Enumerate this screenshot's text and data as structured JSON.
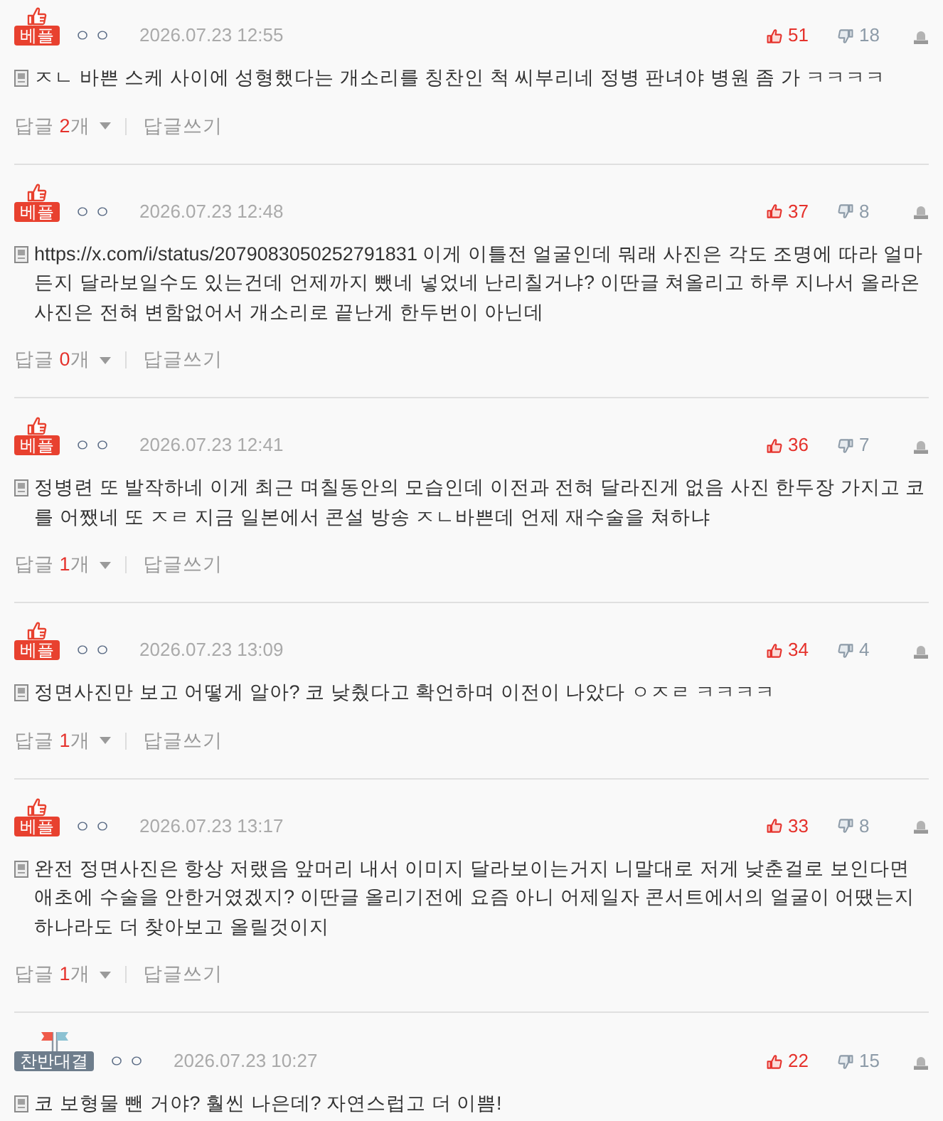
{
  "comments": [
    {
      "badge": {
        "kind": "best",
        "label": "베플"
      },
      "author": "ㅇㅇ",
      "date": "2026.07.23 12:55",
      "likes": "51",
      "dislikes": "18",
      "text": "ㅈㄴ 바쁜 스케 사이에 성형했다는 개소리를 칭찬인 척 씨부리네 정병 판녀야 병원 좀 가 ㅋㅋㅋㅋ",
      "replies": {
        "label": "답글",
        "count": "2",
        "unit": "개",
        "write": "답글쓰기"
      }
    },
    {
      "badge": {
        "kind": "best",
        "label": "베플"
      },
      "author": "ㅇㅇ",
      "date": "2026.07.23 12:48",
      "likes": "37",
      "dislikes": "8",
      "text": "https://x.com/i/status/2079083050252791831 이게 이틀전 얼굴인데 뭐래 사진은 각도 조명에 따라 얼마든지 달라보일수도 있는건데 언제까지 뺐네 넣었네 난리칠거냐? 이딴글 쳐올리고 하루 지나서 올라온 사진은 전혀 변함없어서 개소리로 끝난게 한두번이 아닌데",
      "replies": {
        "label": "답글",
        "count": "0",
        "unit": "개",
        "write": "답글쓰기"
      }
    },
    {
      "badge": {
        "kind": "best",
        "label": "베플"
      },
      "author": "ㅇㅇ",
      "date": "2026.07.23 12:41",
      "likes": "36",
      "dislikes": "7",
      "text": "정병련 또 발작하네 이게 최근 며칠동안의 모습인데 이전과 전혀 달라진게 없음 사진 한두장 가지고 코를 어쨌네 또 ㅈㄹ 지금 일본에서 콘설 방송 ㅈㄴ바쁜데 언제 재수술을 쳐하냐",
      "replies": {
        "label": "답글",
        "count": "1",
        "unit": "개",
        "write": "답글쓰기"
      }
    },
    {
      "badge": {
        "kind": "best",
        "label": "베플"
      },
      "author": "ㅇㅇ",
      "date": "2026.07.23 13:09",
      "likes": "34",
      "dislikes": "4",
      "text": "정면사진만 보고 어떻게 알아? 코 낮췄다고 확언하며 이전이 나았다 ㅇㅈㄹ ㅋㅋㅋㅋ",
      "replies": {
        "label": "답글",
        "count": "1",
        "unit": "개",
        "write": "답글쓰기"
      }
    },
    {
      "badge": {
        "kind": "best",
        "label": "베플"
      },
      "author": "ㅇㅇ",
      "date": "2026.07.23 13:17",
      "likes": "33",
      "dislikes": "8",
      "text": "완전 정면사진은 항상 저랬음 앞머리 내서 이미지 달라보이는거지 니말대로 저게 낮춘걸로 보인다면 애초에 수술을 안한거였겠지? 이딴글 올리기전에 요즘 아니 어제일자 콘서트에서의 얼굴이 어땠는지 하나라도 더 찾아보고 올릴것이지",
      "replies": {
        "label": "답글",
        "count": "1",
        "unit": "개",
        "write": "답글쓰기"
      }
    },
    {
      "badge": {
        "kind": "debate",
        "label": "찬반대결"
      },
      "author": "ㅇㅇ",
      "date": "2026.07.23 10:27",
      "likes": "22",
      "dislikes": "15",
      "text": "코 보형물 뺀 거야? 훨씬 나은데? 자연스럽고 더 이쁨!"
    }
  ]
}
